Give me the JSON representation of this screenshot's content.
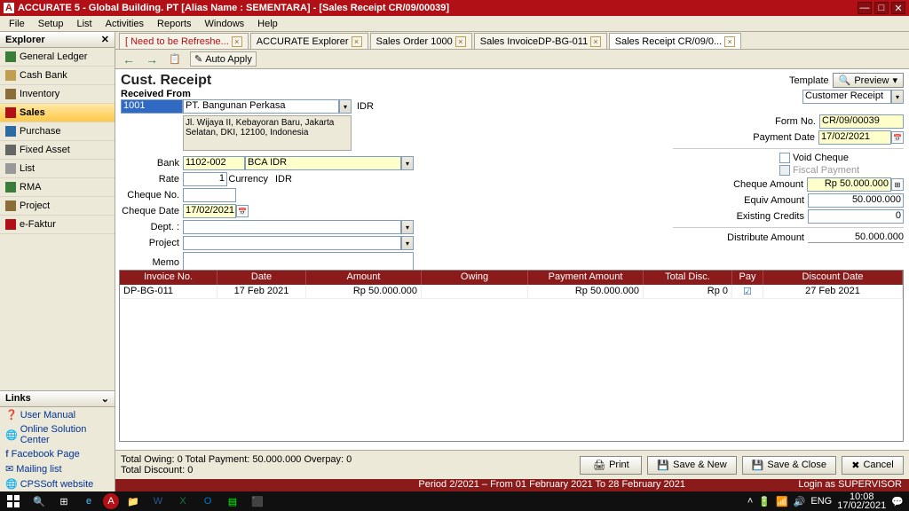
{
  "window": {
    "title": "ACCURATE 5 - Global Building. PT [Alias Name : SEMENTARA] - [Sales Receipt CR/09/00039]"
  },
  "menu": [
    "File",
    "Setup",
    "List",
    "Activities",
    "Reports",
    "Windows",
    "Help"
  ],
  "explorer": {
    "title": "Explorer",
    "items": [
      "General Ledger",
      "Cash Bank",
      "Inventory",
      "Sales",
      "Purchase",
      "Fixed Asset",
      "List",
      "RMA",
      "Project",
      "e-Faktur"
    ],
    "activeIndex": 3
  },
  "links": {
    "title": "Links",
    "items": [
      "User Manual",
      "Online Solution Center",
      "Facebook Page",
      "Mailing list",
      "CPSSoft website"
    ]
  },
  "tabs": [
    {
      "label": "[ Need to be Refreshe..."
    },
    {
      "label": "ACCURATE Explorer"
    },
    {
      "label": "Sales Order 1000"
    },
    {
      "label": "Sales InvoiceDP-BG-011"
    },
    {
      "label": "Sales Receipt CR/09/0..."
    }
  ],
  "toolbar": {
    "autoApply": "Auto Apply"
  },
  "receipt": {
    "title": "Cust. Receipt",
    "receivedFrom": "Received From",
    "custCode": "1001",
    "custName": "PT. Bangunan Perkasa",
    "currency": "IDR",
    "address": "Jl. Wijaya II, Kebayoran Baru, Jakarta Selatan, DKI, 12100, Indonesia",
    "bankLbl": "Bank",
    "bankCode": "1102-002",
    "bankName": "BCA IDR",
    "rateLbl": "Rate",
    "rate": "1",
    "currLbl": "Currency",
    "curr": "IDR",
    "chequeNoLbl": "Cheque No.",
    "chequeNo": "",
    "chequeDateLbl": "Cheque Date",
    "chequeDate": "17/02/2021",
    "deptLbl": "Dept. :",
    "projectLbl": "Project",
    "memoLbl": "Memo",
    "templateLbl": "Template",
    "template": "Customer Receipt",
    "preview": "Preview",
    "formNoLbl": "Form No.",
    "formNo": "CR/09/00039",
    "payDateLbl": "Payment Date",
    "payDate": "17/02/2021",
    "voidCheque": "Void Cheque",
    "fiscalPayment": "Fiscal Payment",
    "chequeAmtLbl": "Cheque Amount",
    "chequeAmt": "Rp 50.000.000",
    "equivLbl": "Equiv Amount",
    "equivAmt": "50.000.000",
    "existCreditLbl": "Existing Credits",
    "existCredit": "0",
    "distLbl": "Distribute Amount",
    "distAmt": "50.000.000"
  },
  "grid": {
    "headers": [
      "Invoice No.",
      "Date",
      "Amount",
      "Owing",
      "Payment Amount",
      "Total Disc.",
      "Pay",
      "Discount Date"
    ],
    "row": {
      "invoice": "DP-BG-011",
      "date": "17 Feb 2021",
      "amount": "Rp 50.000.000",
      "owing": "",
      "payAmount": "Rp 50.000.000",
      "totalDisc": "Rp 0",
      "pay": "✓",
      "discDate": "27 Feb 2021"
    }
  },
  "footer": {
    "totals": "Total Owing:  0    Total Payment:  50.000.000    Overpay:  0",
    "totalDisc": "Total Discount:  0",
    "print": "Print",
    "saveNew": "Save & New",
    "saveClose": "Save & Close",
    "cancel": "Cancel"
  },
  "status": {
    "period": "Period 2/2021 – From 01 February 2021 To 28 February 2021",
    "login": "Login as SUPERVISOR"
  },
  "tray": {
    "lang": "ENG",
    "time": "10:08",
    "date": "17/02/2021"
  }
}
